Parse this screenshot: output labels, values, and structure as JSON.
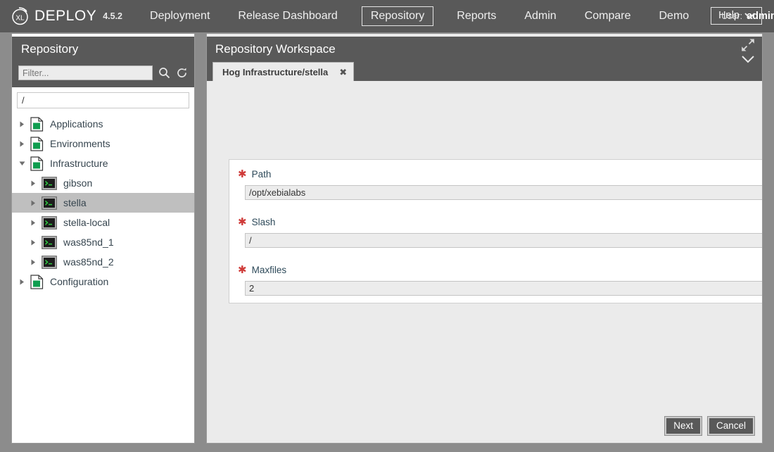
{
  "app": {
    "brand_name": "DEPLOY",
    "brand_mark": "XL",
    "version": "4.5.2",
    "accent_blue": "#199bd7",
    "accent_orange": "#f5a02e",
    "chrome_gray": "#595959"
  },
  "nav": {
    "items": [
      {
        "label": "Deployment",
        "selected": false
      },
      {
        "label": "Release Dashboard",
        "selected": false
      },
      {
        "label": "Repository",
        "selected": true
      },
      {
        "label": "Reports",
        "selected": false
      },
      {
        "label": "Admin",
        "selected": false
      },
      {
        "label": "Compare",
        "selected": false
      },
      {
        "label": "Demo",
        "selected": false
      }
    ],
    "user_label": "User:",
    "user_name": "admin",
    "help_label": "Help"
  },
  "sidebar": {
    "title": "Repository",
    "filter_placeholder": "Filter...",
    "search_icon": "search-icon",
    "refresh_icon": "refresh-icon",
    "root_path_value": "/",
    "tree": [
      {
        "label": "Applications",
        "icon": "folder-green-icon",
        "depth": 1,
        "expanded": false,
        "selected": false
      },
      {
        "label": "Environments",
        "icon": "folder-green-icon",
        "depth": 1,
        "expanded": false,
        "selected": false
      },
      {
        "label": "Infrastructure",
        "icon": "folder-green-icon",
        "depth": 1,
        "expanded": true,
        "selected": false
      },
      {
        "label": "gibson",
        "icon": "terminal-host-icon",
        "depth": 2,
        "expanded": false,
        "selected": false
      },
      {
        "label": "stella",
        "icon": "terminal-host-icon",
        "depth": 2,
        "expanded": false,
        "selected": true
      },
      {
        "label": "stella-local",
        "icon": "terminal-host-icon",
        "depth": 2,
        "expanded": false,
        "selected": false
      },
      {
        "label": "was85nd_1",
        "icon": "terminal-host-icon",
        "depth": 2,
        "expanded": false,
        "selected": false
      },
      {
        "label": "was85nd_2",
        "icon": "terminal-host-icon",
        "depth": 2,
        "expanded": false,
        "selected": false
      },
      {
        "label": "Configuration",
        "icon": "folder-green-icon",
        "depth": 1,
        "expanded": false,
        "selected": false
      }
    ]
  },
  "workspace": {
    "title": "Repository Workspace",
    "expand_icon": "expand-arrows-icon",
    "collapse_icon": "chevron-down-icon",
    "tabs": [
      {
        "label": "Hog Infrastructure/stella",
        "close": "✖",
        "active": true
      }
    ],
    "form": {
      "fields": [
        {
          "label": "Path",
          "value": "/opt/xebialabs",
          "required": true,
          "required_marker": "✱"
        },
        {
          "label": "Slash",
          "value": "/",
          "required": true,
          "required_marker": "✱"
        },
        {
          "label": "Maxfiles",
          "value": "2",
          "required": true,
          "required_marker": "✱"
        }
      ]
    },
    "buttons": {
      "next_label": "Next",
      "cancel_label": "Cancel"
    }
  }
}
